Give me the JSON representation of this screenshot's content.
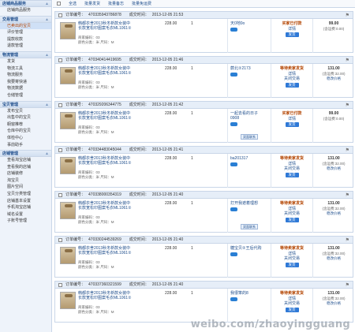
{
  "sidebar": {
    "top_group": "店铺商品服务",
    "top_item": "店铺商品服务",
    "groups": [
      {
        "title": "交易管理",
        "items": [
          "已卖出的宝贝",
          "评价管理",
          "提款收款",
          "退款管理"
        ],
        "active": 0
      },
      {
        "title": "物流管理",
        "items": [
          "发货",
          "物流工具",
          "物流服务",
          "我要寄快递",
          "物流数据",
          "仓储管理"
        ]
      },
      {
        "title": "宝贝管理",
        "items": [
          "发布宝贝",
          "出售中的宝贝",
          "橱窗推荐",
          "仓库中的宝贝",
          "体检中心",
          "事前助手"
        ]
      },
      {
        "title": "店铺管理",
        "items": [
          "查看淘宝店铺",
          "查看我的店铺",
          "店铺装修",
          "淘宝贝",
          "图片空间",
          "宝贝分类管理",
          "店铺基本设置",
          "手机淘宝店铺",
          "域名设置",
          "子账号管理"
        ]
      }
    ]
  },
  "toolbar": {
    "select_all": "全选",
    "b1": "批量发货",
    "b2": "批量备忘",
    "b3": "批量免运费"
  },
  "orders": [
    {
      "no_label": "订单编号：",
      "no": "470335943786878",
      "time_label": "成交时间：",
      "time": "2013-12-05 21:53",
      "title": "韩都衣舍2013秋冬新款女装中长款宽松印图案毛衣ML1061②",
      "meta1": "商家编码：03",
      "meta2": "颜色分类：米  尺码：M",
      "price": "228.00",
      "qty": "1",
      "buyer": "天0地0o",
      "status": "买家已付款",
      "link1": "详情",
      "btn": "发货",
      "amount": "99.00",
      "ship": "(含运费:0.00)",
      "mod": ""
    },
    {
      "no_label": "订单编号：",
      "no": "470340414419695",
      "time_label": "成交时间：",
      "time": "2013-12-05 21:46",
      "title": "韩都衣舍2013秋冬新款女装中长款宽松印图案毛衣ML1061②",
      "meta1": "商家编码：03",
      "meta2": "颜色分类：米  尺码：M",
      "price": "228.00",
      "qty": "1",
      "buyer": "蕨北②2173",
      "status": "等待卖家发货",
      "link1": "详情",
      "link2": "关闭交易",
      "btn": "发货",
      "amount": "131.00",
      "ship": "(含运费:32.00)",
      "mod": "稳改价格"
    },
    {
      "no_label": "订单编号：",
      "no": "470329206344775",
      "time_label": "成交时间：",
      "time": "2013-12-05 21:42",
      "title": "韩都衣舍2013秋冬新款女装中长款宽松印图案毛衣ML1061②",
      "meta1": "商家编码：03",
      "meta2": "颜色分类：米  尺码：M",
      "price": "228.00",
      "qty": "1",
      "buyer": "一起去看的日子0908",
      "status": "买家已付款",
      "link1": "详情",
      "btn": "发货",
      "amount": "99.00",
      "ship": "(含运费:0.00)",
      "mod": "",
      "badge": "双面联系"
    },
    {
      "no_label": "订单编号：",
      "no": "470334483045044",
      "time_label": "成交时间：",
      "time": "2013-12-05 21:41",
      "title": "韩都衣舍2013秋冬新款女装中长款宽松印图案毛衣ML1061②",
      "meta1": "商家编码：03",
      "meta2": "颜色分类：米  尺码：M",
      "price": "228.00",
      "qty": "1",
      "buyer": "ba201317",
      "status": "等待卖家发货",
      "link1": "详情",
      "link2": "关闭交易",
      "btn": "发货",
      "amount": "131.00",
      "ship": "(含运费:32.00)",
      "mod": "稳改价格"
    },
    {
      "no_label": "订单编号：",
      "no": "470338000354319",
      "time_label": "成交时间：",
      "time": "2013-12-05 21:40",
      "title": "韩都衣舍2013秋冬新款女装中长款宽松印图案毛衣ML1061②",
      "meta1": "商家编码：03",
      "meta2": "颜色分类：米  尺码：M",
      "price": "228.00",
      "qty": "1",
      "buyer": "打开我遮着理想",
      "status": "等待卖家发货",
      "link1": "详情",
      "link2": "关闭交易",
      "btn": "发货",
      "amount": "131.00",
      "ship": "(含运费:32.00)",
      "mod": "稳改价格",
      "badge": "双面联系"
    },
    {
      "no_label": "订单编号：",
      "no": "470330244539269",
      "time_label": "成交时间：",
      "time": "2013-12-05 21:40",
      "title": "韩都衣舍2013秋冬新款女装中长款宽松印图案毛衣ML1061②",
      "meta1": "商家编码：03",
      "meta2": "颜色分类：米  尺码：M",
      "price": "228.00",
      "qty": "1",
      "buyer": "糖宝贝②王后代购",
      "status": "等待卖家发货",
      "link1": "详情",
      "link2": "关闭交易",
      "btn": "发货",
      "amount": "131.00",
      "ship": "(含运费:32.00)",
      "mod": "稳改价格"
    },
    {
      "no_label": "订单编号：",
      "no": "470337360321599",
      "time_label": "成交时间：",
      "time": "2013-12-05 21:40",
      "title": "韩都衣舍2013秋冬新款女装中长款宽松印图案毛衣ML1061②",
      "meta1": "商家编码：03",
      "meta2": "颜色分类：米  尺码：M",
      "price": "228.00",
      "qty": "1",
      "buyer": "我很笨的8",
      "status": "等待卖家发货",
      "link1": "详情",
      "link2": "关闭交易",
      "btn": "发货",
      "amount": "131.00",
      "ship": "(含运费:32.00)",
      "mod": "稳改价格"
    }
  ],
  "watermark": "weibo.com/zhaoyingguang"
}
